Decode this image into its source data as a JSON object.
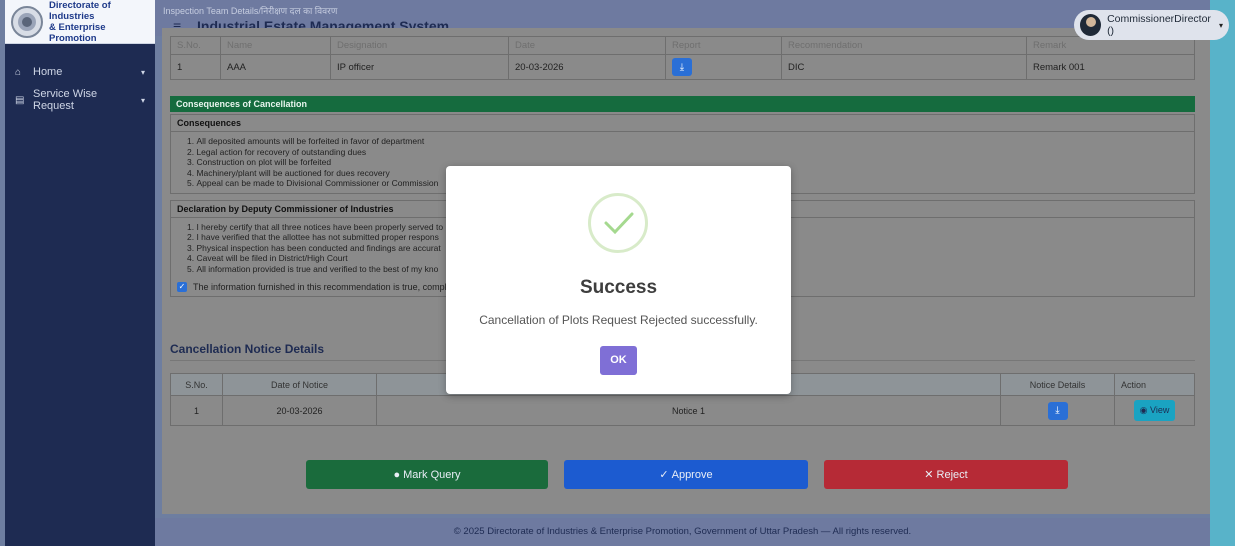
{
  "brand": {
    "line1": "Directorate of Industries",
    "line2": "& Enterprise Promotion"
  },
  "sidebar": {
    "items": [
      {
        "label": "Home",
        "icon": "home-icon"
      },
      {
        "label": "Service Wise Request",
        "icon": "clipboard-icon"
      }
    ]
  },
  "header": {
    "system_name": "Industrial Estate Management System",
    "faint_title": "Inspection Team Details/निरीक्षण दल का विवरण",
    "user": "CommissionerDirector ()"
  },
  "inspection": {
    "columns": [
      "S.No.",
      "Name",
      "Designation",
      "Date",
      "Report",
      "Recommendation",
      "Remark"
    ],
    "rows": [
      {
        "sno": "1",
        "name": "AAA",
        "designation": "IP officer",
        "date": "20-03-2026",
        "recommendation": "DIC",
        "remark": "Remark 001"
      }
    ]
  },
  "consequences": {
    "header": "Consequences of Cancellation",
    "title": "Consequences",
    "items": [
      "All deposited amounts will be forfeited in favor of department",
      "Legal action for recovery of outstanding dues",
      "Construction on plot will be forfeited",
      "Machinery/plant will be auctioned for dues recovery",
      "Appeal can be made to Divisional Commissioner or Commission"
    ]
  },
  "declaration": {
    "title": "Declaration by Deputy Commissioner of Industries",
    "items": [
      "I hereby certify that all three notices have been properly served to",
      "I have verified that the allottee has not submitted proper respons",
      "Physical inspection has been conducted and findings are accurat",
      "Caveat will be filed in District/High Court",
      "All information provided is true and verified to the best of my kno"
    ],
    "checkbox_text": "The information furnished in this recommendation is true, complet"
  },
  "notices": {
    "title": "Cancellation Notice Details",
    "columns": [
      "S.No.",
      "Date of Notice",
      "Notice Details",
      "Action"
    ],
    "rows": [
      {
        "sno": "1",
        "date": "20-03-2026",
        "name": "Notice 1",
        "action": "View"
      }
    ]
  },
  "actions": {
    "mark_query": "Mark Query",
    "approve": "Approve",
    "reject": "Reject"
  },
  "footer": "© 2025 Directorate of Industries & Enterprise Promotion, Government of Uttar Pradesh — All rights reserved.",
  "modal": {
    "title": "Success",
    "message": "Cancellation of Plots Request Rejected successfully.",
    "ok": "OK"
  },
  "colors": {
    "accent_green": "#156b3e",
    "approve_blue": "#1c5bd0",
    "reject_red": "#b62a36",
    "ok_purple": "#7f6fd6"
  }
}
